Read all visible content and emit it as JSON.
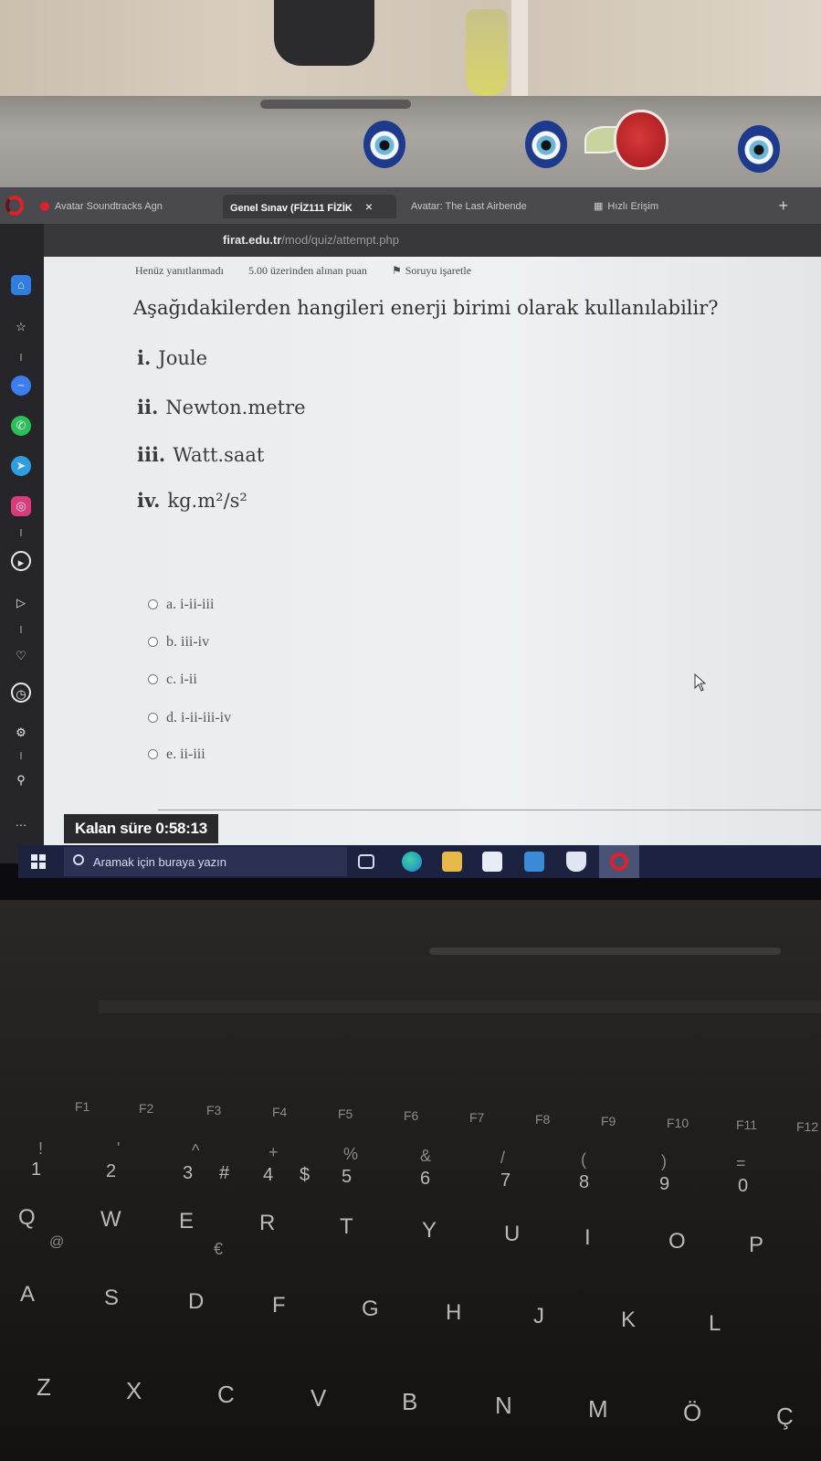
{
  "browser": {
    "tabs": [
      {
        "label": "Avatar Soundtracks Agn",
        "active": false,
        "icon": "youtube-icon"
      },
      {
        "label": "Genel Sınav (FİZ111 FİZİK",
        "active": true,
        "icon": "moodle-icon"
      },
      {
        "label": "Avatar: The Last Airbende",
        "active": false,
        "icon": "tab-icon"
      },
      {
        "label": "Hızlı Erişim",
        "active": false,
        "icon": "grid-icon"
      }
    ],
    "close_glyph": "×",
    "new_tab_glyph": "+",
    "url_domain": "firat.edu.tr",
    "url_path": "/mod/quiz/attempt.php"
  },
  "quiz": {
    "status": "Henüz yanıtlanmadı",
    "points": "5.00 üzerinden alınan puan",
    "flag": "Soruyu işaretle",
    "question": "Aşağıdakilerden hangileri enerji birimi olarak kullanılabilir?",
    "statements": [
      {
        "num": "i.",
        "text": "Joule"
      },
      {
        "num": "ii.",
        "text": "Newton.metre"
      },
      {
        "num": "iii.",
        "text": "Watt.saat"
      },
      {
        "num": "iv.",
        "text": "kg.m²/s²"
      }
    ],
    "answers": [
      "a. i-ii-iii",
      "b. iii-iv",
      "c. i-ii",
      "d. i-ii-iii-iv",
      "e. ii-iii"
    ],
    "timer": "Kalan süre 0:58:13"
  },
  "taskbar": {
    "search_placeholder": "Aramak için buraya yazın"
  },
  "keyboard": {
    "fkeys": [
      "F1",
      "F2",
      "F3",
      "F4",
      "F5",
      "F6",
      "F7",
      "F8",
      "F9",
      "F10",
      "F11",
      "F12"
    ],
    "number_row": [
      "1",
      "2",
      "3",
      "#",
      "4",
      "$",
      "5",
      "6",
      "7",
      "8",
      "9",
      "0"
    ],
    "number_shift": [
      "!",
      "'",
      "^",
      "+",
      "%",
      "&",
      "/",
      "(",
      ")",
      "="
    ],
    "row_q": [
      "Q",
      "W",
      "E",
      "R",
      "T",
      "Y",
      "U",
      "I",
      "O",
      "P"
    ],
    "row_a": [
      "A",
      "S",
      "D",
      "F",
      "G",
      "H",
      "J",
      "K",
      "L"
    ],
    "row_z": [
      "Z",
      "X",
      "C",
      "V",
      "B",
      "N",
      "M",
      "Ö",
      "Ç"
    ],
    "alt_glyphs": [
      "@",
      "€"
    ]
  },
  "colors": {
    "opera_red": "#e0202a",
    "page_background": "#eef1f2",
    "taskbar": "#1c2340"
  }
}
